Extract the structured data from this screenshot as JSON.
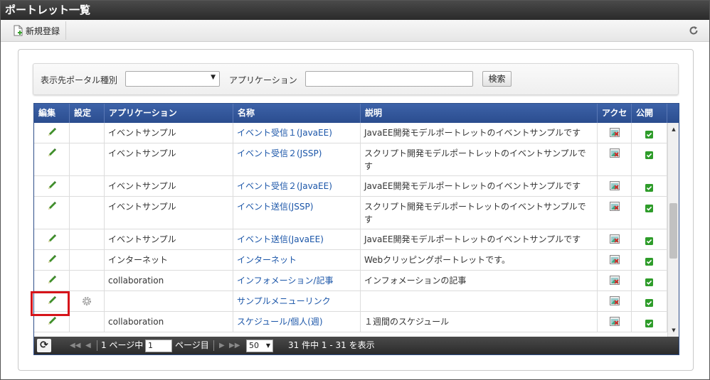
{
  "window": {
    "title": "ポートレット一覧"
  },
  "toolbar": {
    "new_label": "新規登録"
  },
  "search": {
    "portal_type_label": "表示先ポータル種別",
    "portal_type_value": "",
    "application_label": "アプリケーション",
    "application_value": "",
    "search_button": "検索"
  },
  "grid": {
    "columns": [
      "編集",
      "設定",
      "アプリケーション",
      "名称",
      "説明",
      "アクセ",
      "公開"
    ],
    "rows": [
      {
        "app": "イベントサンプル",
        "name": "イベント受信１(JavaEE)",
        "desc": "JavaEE開発モデルポートレットのイベントサンプルです",
        "has_settings": false
      },
      {
        "app": "イベントサンプル",
        "name": "イベント受信２(JSSP)",
        "desc": "スクリプト開発モデルポートレットのイベントサンプルです",
        "has_settings": false
      },
      {
        "app": "イベントサンプル",
        "name": "イベント受信２(JavaEE)",
        "desc": "JavaEE開発モデルポートレットのイベントサンプルです",
        "has_settings": false
      },
      {
        "app": "イベントサンプル",
        "name": "イベント送信(JSSP)",
        "desc": "スクリプト開発モデルポートレットのイベントサンプルです",
        "has_settings": false
      },
      {
        "app": "イベントサンプル",
        "name": "イベント送信(JavaEE)",
        "desc": "JavaEE開発モデルポートレットのイベントサンプルです",
        "has_settings": false
      },
      {
        "app": "インターネット",
        "name": "インターネット",
        "desc": "Webクリッピングポートレットです。",
        "has_settings": false
      },
      {
        "app": "collaboration",
        "name": "インフォメーション/記事",
        "desc": "インフォメーションの記事",
        "has_settings": false
      },
      {
        "app": "",
        "name": "サンプルメニューリンク",
        "desc": "",
        "has_settings": true
      },
      {
        "app": "collaboration",
        "name": "スケジュール/個人(週)",
        "desc": "１週間のスケジュール",
        "has_settings": false
      }
    ]
  },
  "pager": {
    "page_prefix": "1 ページ中",
    "page_value": "1",
    "page_suffix": "ページ目",
    "page_size": "50",
    "summary": "31 件中 1 - 31 を表示"
  },
  "colors": {
    "header_blue": "#2b4d8f",
    "link_blue": "#1a55a8",
    "highlight_red": "#d6141a",
    "pencil_green": "#3f8f2a"
  },
  "icons": {
    "edit": "pencil-icon",
    "settings": "gear-icon",
    "access": "access-settings-icon",
    "public": "checkbox-checked-icon",
    "refresh": "refresh-icon",
    "new": "new-document-icon"
  }
}
